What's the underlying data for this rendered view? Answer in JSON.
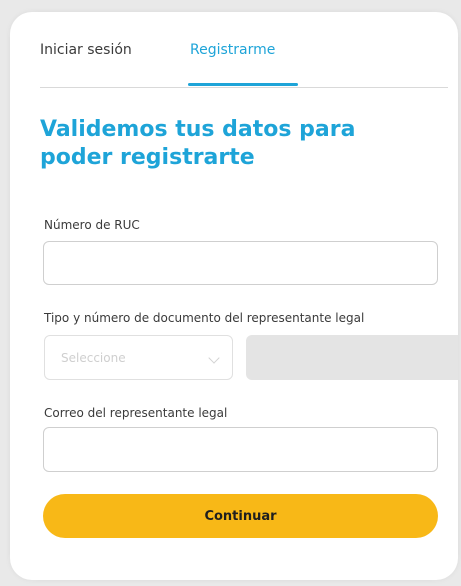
{
  "tabs": {
    "login": "Iniciar sesión",
    "register": "Registrarme"
  },
  "heading": "Validemos tus datos para poder registrarte",
  "form": {
    "ruc_label": "Número de RUC",
    "ruc_value": "",
    "document_label": "Tipo y número de documento del representante legal",
    "document_type_placeholder": "Seleccione",
    "document_number_value": "",
    "email_label": "Correo del representante legal",
    "email_value": ""
  },
  "submit_label": "Continuar",
  "colors": {
    "accent": "#1ea4d8",
    "button": "#f8b817"
  }
}
